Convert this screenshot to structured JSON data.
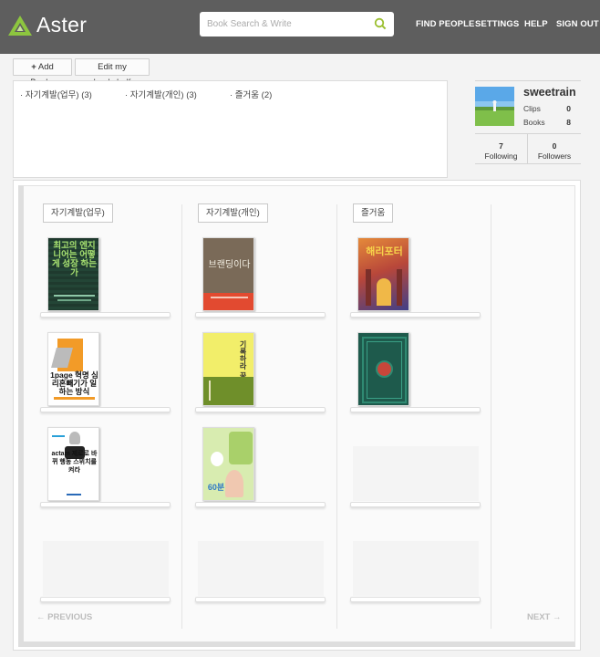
{
  "header": {
    "app_name": "Aster",
    "search_placeholder": "Book Search & Write",
    "nav": [
      "FIND PEOPLE",
      "SETTINGS",
      "HELP",
      "SIGN OUT"
    ]
  },
  "toolbar": {
    "add_books": "Add Books",
    "edit_bookshelf": "Edit my bookshelf"
  },
  "categories": [
    "· 자기계발(업무) (3)",
    "· 자기계발(개인) (3)",
    "· 즐거움 (2)"
  ],
  "profile": {
    "username": "sweetrain",
    "clips_label": "Clips",
    "clips_value": "0",
    "books_label": "Books",
    "books_value": "8",
    "following_value": "7",
    "following_label": "Following",
    "followers_value": "0",
    "followers_label": "Followers"
  },
  "shelves": [
    {
      "name": "자기계발(업무)",
      "books": [
        {
          "cover_text": "최고의 엔지니어는 어떻게 성장 하는가",
          "color": "#1f3a2e"
        },
        {
          "cover_text": "1page 혁명 심리혼빼기가 일하는 방식",
          "color": "#ffffff"
        },
        {
          "cover_text": "actam 제로로 바뀌 행동 스위치를 켜라",
          "color": "#ffffff"
        }
      ]
    },
    {
      "name": "자기계발(개인)",
      "books": [
        {
          "cover_text": "브랜딩이다",
          "color": "#7a6a58"
        },
        {
          "cover_text": "기록하라 꿈은",
          "color": "#f2ee6a"
        },
        {
          "cover_text": "60분",
          "color": "#d8ecb0"
        }
      ]
    },
    {
      "name": "즐거움",
      "books": [
        {
          "cover_text": "해리포터",
          "color": "#c9682e"
        },
        {
          "cover_text": "",
          "color": "#1e5a4c"
        }
      ]
    }
  ],
  "pagination": {
    "previous": "← PREVIOUS",
    "next": "NEXT →"
  },
  "colors": {
    "header_bg": "#5e5e5e",
    "accent": "#8dc63f"
  }
}
